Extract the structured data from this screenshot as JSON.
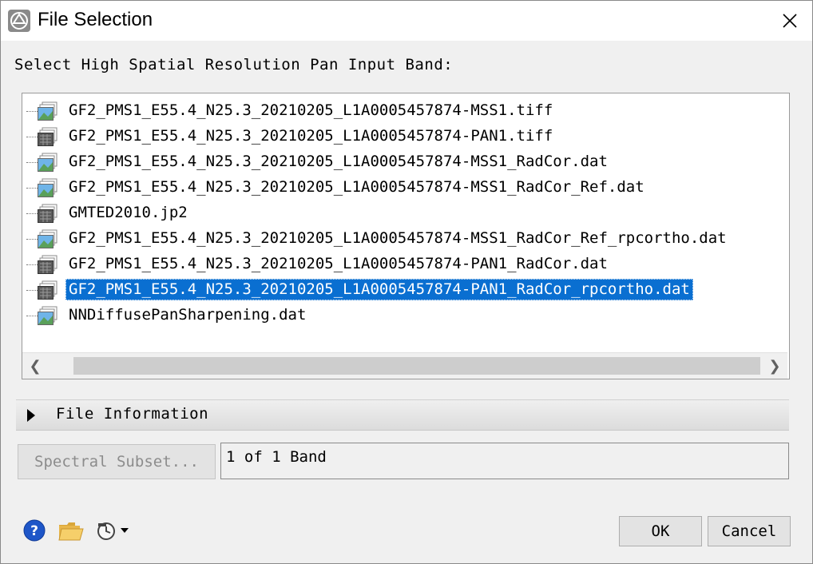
{
  "window": {
    "title": "File Selection",
    "close_glyph": "✕"
  },
  "prompt": "Select High Spatial Resolution Pan Input Band:",
  "files": [
    {
      "name": "GF2_PMS1_E55.4_N25.3_20210205_L1A0005457874-MSS1.tiff",
      "icon": "multispectral-image-icon",
      "selected": false
    },
    {
      "name": "GF2_PMS1_E55.4_N25.3_20210205_L1A0005457874-PAN1.tiff",
      "icon": "grayscale-image-icon",
      "selected": false
    },
    {
      "name": "GF2_PMS1_E55.4_N25.3_20210205_L1A0005457874-MSS1_RadCor.dat",
      "icon": "multispectral-image-icon",
      "selected": false
    },
    {
      "name": "GF2_PMS1_E55.4_N25.3_20210205_L1A0005457874-MSS1_RadCor_Ref.dat",
      "icon": "multispectral-image-icon",
      "selected": false
    },
    {
      "name": "GMTED2010.jp2",
      "icon": "grayscale-image-icon",
      "selected": false
    },
    {
      "name": "GF2_PMS1_E55.4_N25.3_20210205_L1A0005457874-MSS1_RadCor_Ref_rpcortho.dat",
      "icon": "multispectral-image-icon",
      "selected": false
    },
    {
      "name": "GF2_PMS1_E55.4_N25.3_20210205_L1A0005457874-PAN1_RadCor.dat",
      "icon": "grayscale-image-icon",
      "selected": false
    },
    {
      "name": "GF2_PMS1_E55.4_N25.3_20210205_L1A0005457874-PAN1_RadCor_rpcortho.dat",
      "icon": "grayscale-image-icon",
      "selected": true
    },
    {
      "name": "NNDiffusePanSharpening.dat",
      "icon": "multispectral-image-icon",
      "selected": false
    }
  ],
  "scroll": {
    "left_glyph": "❮",
    "right_glyph": "❯"
  },
  "file_info_label": "File Information",
  "spectral_subset_label": "Spectral Subset...",
  "band_info": "1 of 1 Band",
  "buttons": {
    "ok": "OK",
    "cancel": "Cancel"
  },
  "colors": {
    "selection": "#0a6fd1",
    "help": "#1e56c8",
    "folder": "#f2c14e"
  }
}
